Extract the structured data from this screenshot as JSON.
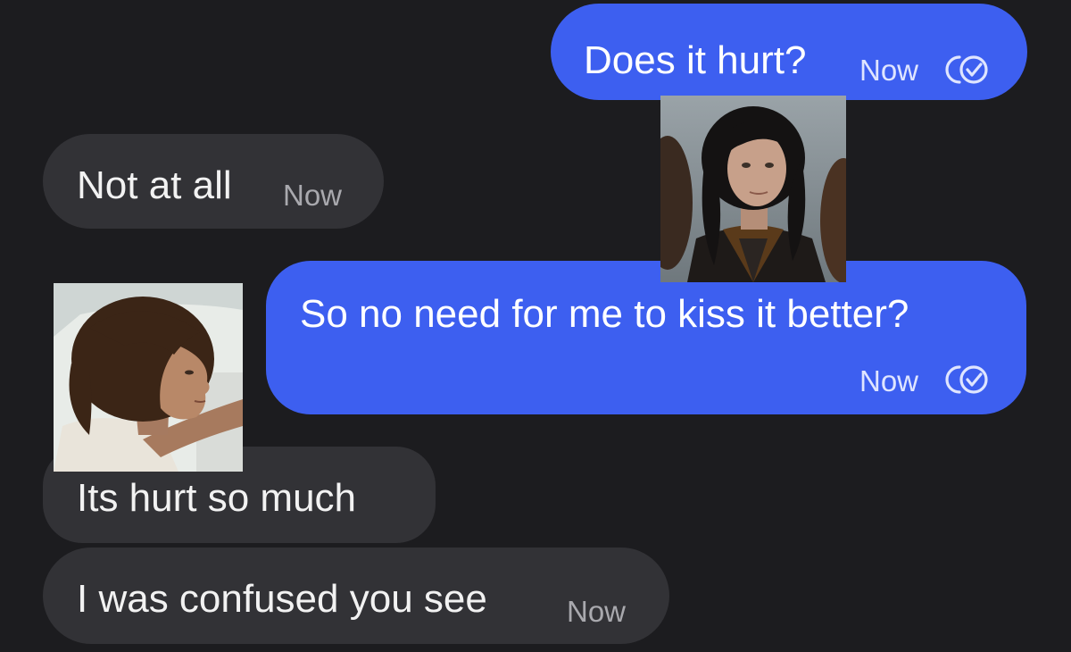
{
  "colors": {
    "background": "#1c1c1f",
    "sent_bubble": "#3d5ff0",
    "received_bubble": "#323236"
  },
  "messages": [
    {
      "direction": "sent",
      "text": "Does it hurt?",
      "time": "Now",
      "status_icon": "read-receipt-icon"
    },
    {
      "direction": "received",
      "text": "Not at all",
      "time": "Now"
    },
    {
      "direction": "sent",
      "text": "So no need for me to kiss it better?",
      "time": "Now",
      "status_icon": "read-receipt-icon"
    },
    {
      "direction": "received",
      "text": "Its hurt so much"
    },
    {
      "direction": "received",
      "text": "I was confused you see",
      "time": "Now"
    }
  ],
  "avatars": [
    {
      "name": "dark-curly-haired-character-portrait"
    },
    {
      "name": "brown-curly-haired-character-portrait"
    }
  ]
}
